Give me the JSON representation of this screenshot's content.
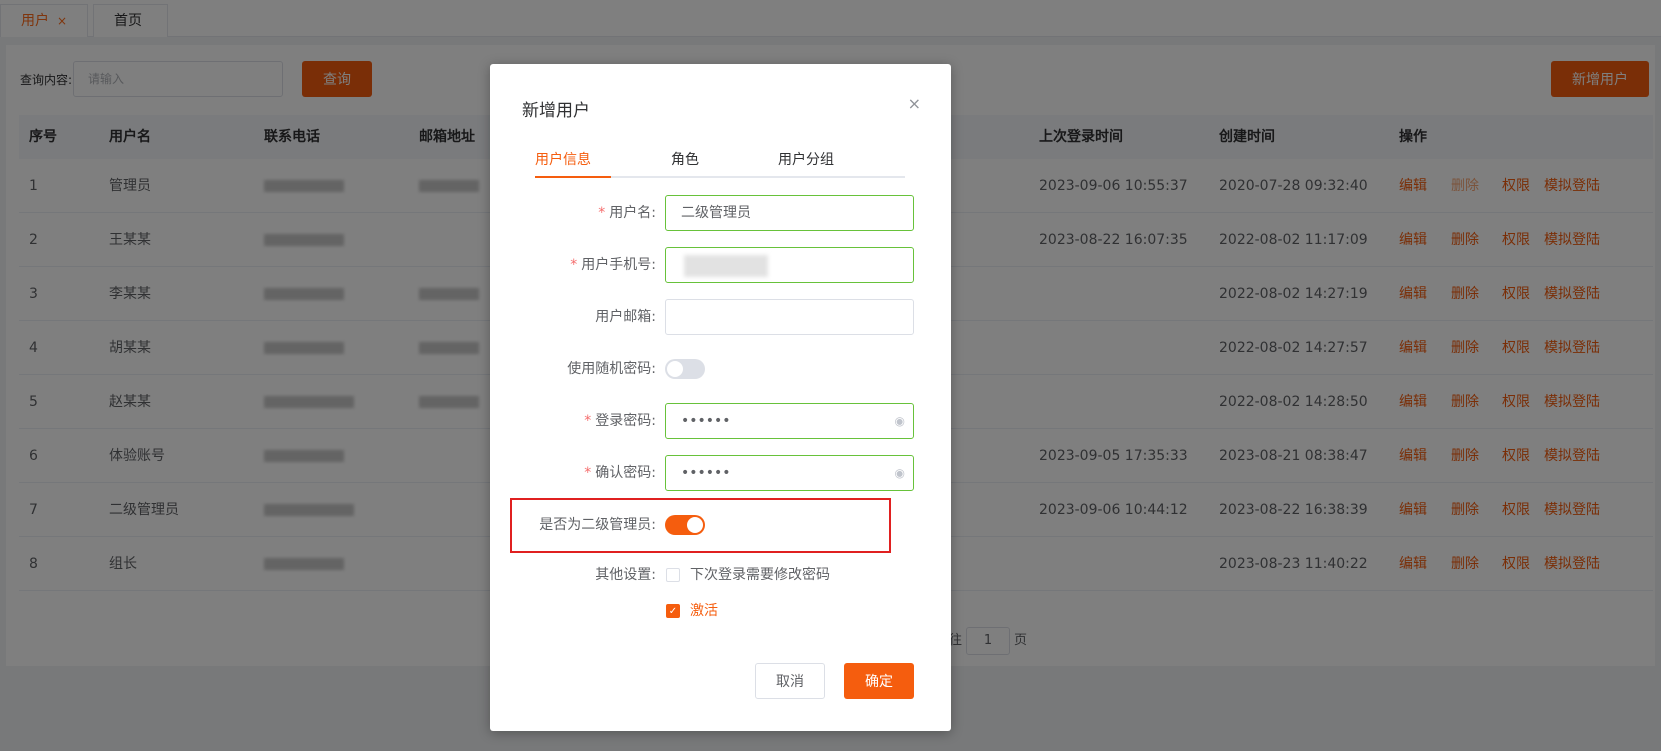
{
  "tabs": [
    {
      "label": "用户",
      "close": "×"
    },
    {
      "label": "首页"
    }
  ],
  "search": {
    "label": "查询内容:",
    "placeholder": "请输入",
    "query_button": "查询"
  },
  "new_user_button": "新增用户",
  "table": {
    "headers": [
      "序号",
      "用户名",
      "联系电话",
      "邮箱地址",
      "上次登录时间",
      "创建时间",
      "操作"
    ],
    "rows": [
      {
        "idx": "1",
        "name": "管理员",
        "last_login": "2023-09-06 10:55:37",
        "created": "2020-07-28 09:32:40",
        "delete_disabled": true
      },
      {
        "idx": "2",
        "name": "王某某",
        "last_login": "2023-08-22 16:07:35",
        "created": "2022-08-02 11:17:09"
      },
      {
        "idx": "3",
        "name": "李某某",
        "last_login": "",
        "created": "2022-08-02 14:27:19"
      },
      {
        "idx": "4",
        "name": "胡某某",
        "last_login": "",
        "created": "2022-08-02 14:27:57"
      },
      {
        "idx": "5",
        "name": "赵某某",
        "last_login": "",
        "created": "2022-08-02 14:28:50"
      },
      {
        "idx": "6",
        "name": "体验账号",
        "last_login": "2023-09-05 17:35:33",
        "created": "2023-08-21 08:38:47"
      },
      {
        "idx": "7",
        "name": "二级管理员",
        "last_login": "2023-09-06 10:44:12",
        "created": "2023-08-22 16:38:39"
      },
      {
        "idx": "8",
        "name": "组长",
        "last_login": "",
        "created": "2023-08-23 11:40:22"
      }
    ],
    "ops": [
      "编辑",
      "删除",
      "权限",
      "模拟登陆"
    ]
  },
  "pager": {
    "goto": "前往",
    "page": "1",
    "unit": "页"
  },
  "dialog": {
    "title": "新增用户",
    "close": "×",
    "tabs": [
      "用户信息",
      "角色",
      "用户分组"
    ],
    "fields": {
      "username_label": "用户名:",
      "username_value": "二级管理员",
      "phone_label": "用户手机号:",
      "email_label": "用户邮箱:",
      "random_pwd_label": "使用随机密码:",
      "password_label": "登录密码:",
      "password_value": "••••••",
      "confirm_label": "确认密码:",
      "confirm_value": "••••••",
      "second_admin_label": "是否为二级管理员:",
      "other_label": "其他设置:",
      "change_pwd_label": "下次登录需要修改密码",
      "active_label": "激活"
    },
    "required_mark": "*",
    "cancel": "取消",
    "confirm": "确定",
    "random_pwd_on": false,
    "second_admin_on": true,
    "change_pwd_checked": false,
    "active_checked": true
  }
}
